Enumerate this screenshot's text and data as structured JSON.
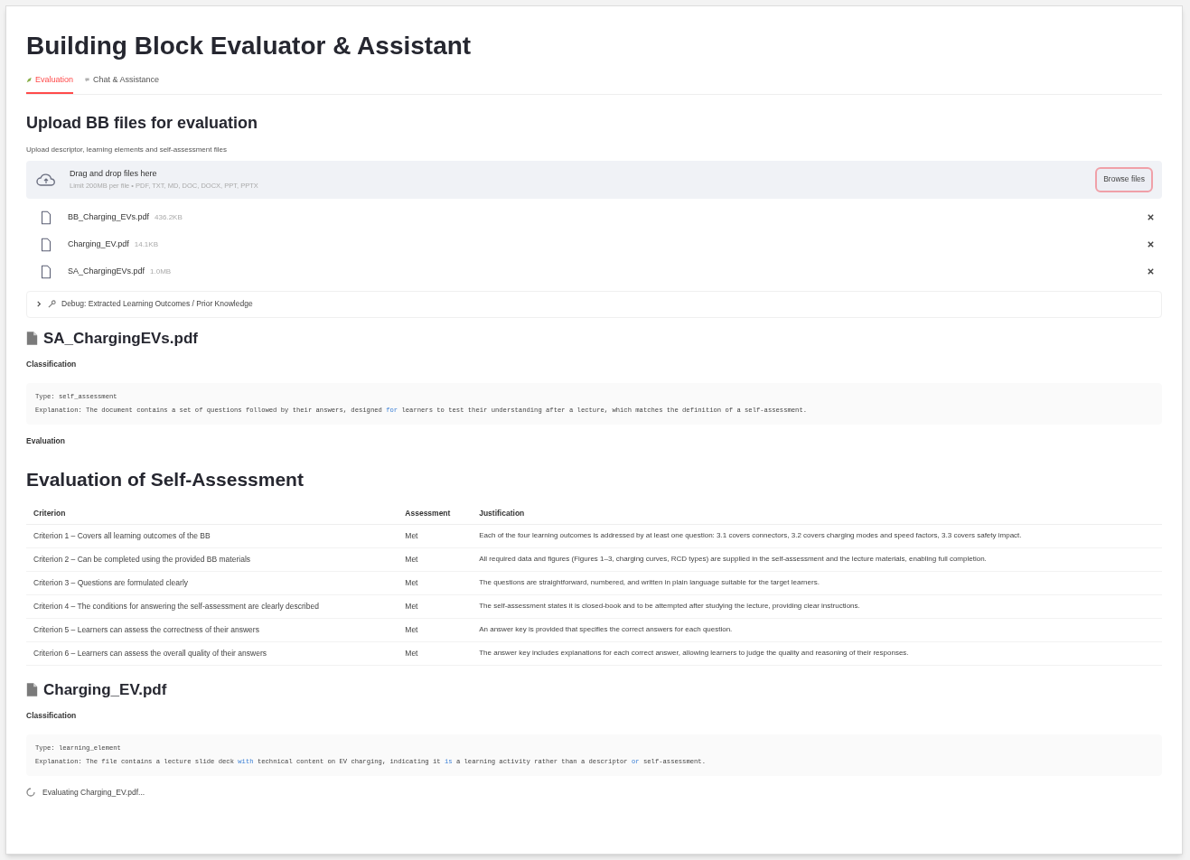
{
  "title": "Building Block Evaluator & Assistant",
  "tabs": [
    {
      "label": "Evaluation",
      "selected": true
    },
    {
      "label": "Chat & Assistance",
      "selected": false
    }
  ],
  "upload": {
    "heading": "Upload BB files for evaluation",
    "label": "Upload descriptor, learning elements and self-assessment files",
    "drop_text": "Drag and drop files here",
    "limit_text": "Limit 200MB per file • PDF, TXT, MD, DOC, DOCX, PPT, PPTX",
    "browse_button": "Browse files",
    "files": [
      {
        "name": "BB_Charging_EVs.pdf",
        "size": "436.2KB"
      },
      {
        "name": "Charging_EV.pdf",
        "size": "14.1KB"
      },
      {
        "name": "SA_ChargingEVs.pdf",
        "size": "1.0MB"
      }
    ]
  },
  "debug_expander": {
    "label": "Debug: Extracted Learning Outcomes / Prior Knowledge",
    "expanded": false
  },
  "results": [
    {
      "file_heading": "SA_ChargingEVs.pdf",
      "classification_label": "Classification",
      "code_lines": [
        [
          {
            "kind": "text",
            "text": "Type: self_assessment"
          }
        ],
        [
          {
            "kind": "text",
            "text": "Explanation: The document contains a set of questions followed by their answers, designed "
          },
          {
            "kind": "keyword",
            "text": "for"
          },
          {
            "kind": "text",
            "text": " learners to test their understanding after a lecture, which matches the definition of a self-assessment."
          }
        ]
      ],
      "evaluation_label": "Evaluation",
      "evaluation_heading": "Evaluation of Self-Assessment",
      "table": {
        "columns": [
          "Criterion",
          "Assessment",
          "Justification"
        ],
        "rows": [
          [
            "Criterion 1 – Covers all learning outcomes of the BB",
            "Met",
            "Each of the four learning outcomes is addressed by at least one question: 3.1 covers connectors, 3.2 covers charging modes and speed factors, 3.3 covers safety impact."
          ],
          [
            "Criterion 2 – Can be completed using the provided BB materials",
            "Met",
            "All required data and figures (Figures 1–3, charging curves, RCD types) are supplied in the self-assessment and the lecture materials, enabling full completion."
          ],
          [
            "Criterion 3 – Questions are formulated clearly",
            "Met",
            "The questions are straightforward, numbered, and written in plain language suitable for the target learners."
          ],
          [
            "Criterion 4 – The conditions for answering the self-assessment are clearly described",
            "Met",
            "The self-assessment states it is closed-book and to be attempted after studying the lecture, providing clear instructions."
          ],
          [
            "Criterion 5 – Learners can assess the correctness of their answers",
            "Met",
            "An answer key is provided that specifies the correct answers for each question."
          ],
          [
            "Criterion 6 – Learners can assess the overall quality of their answers",
            "Met",
            "The answer key includes explanations for each correct answer, allowing learners to judge the quality and reasoning of their responses."
          ]
        ]
      }
    },
    {
      "file_heading": "Charging_EV.pdf",
      "classification_label": "Classification",
      "code_lines": [
        [
          {
            "kind": "text",
            "text": "Type: learning_element"
          }
        ],
        [
          {
            "kind": "text",
            "text": "Explanation: The file contains a lecture slide deck "
          },
          {
            "kind": "keyword",
            "text": "with"
          },
          {
            "kind": "text",
            "text": " technical content on EV charging, indicating it "
          },
          {
            "kind": "keyword",
            "text": "is"
          },
          {
            "kind": "text",
            "text": " a learning activity rather than a descriptor "
          },
          {
            "kind": "keyword",
            "text": "or"
          },
          {
            "kind": "text",
            "text": " self-assessment."
          }
        ]
      ],
      "status": "Evaluating Charging_EV.pdf..."
    }
  ]
}
